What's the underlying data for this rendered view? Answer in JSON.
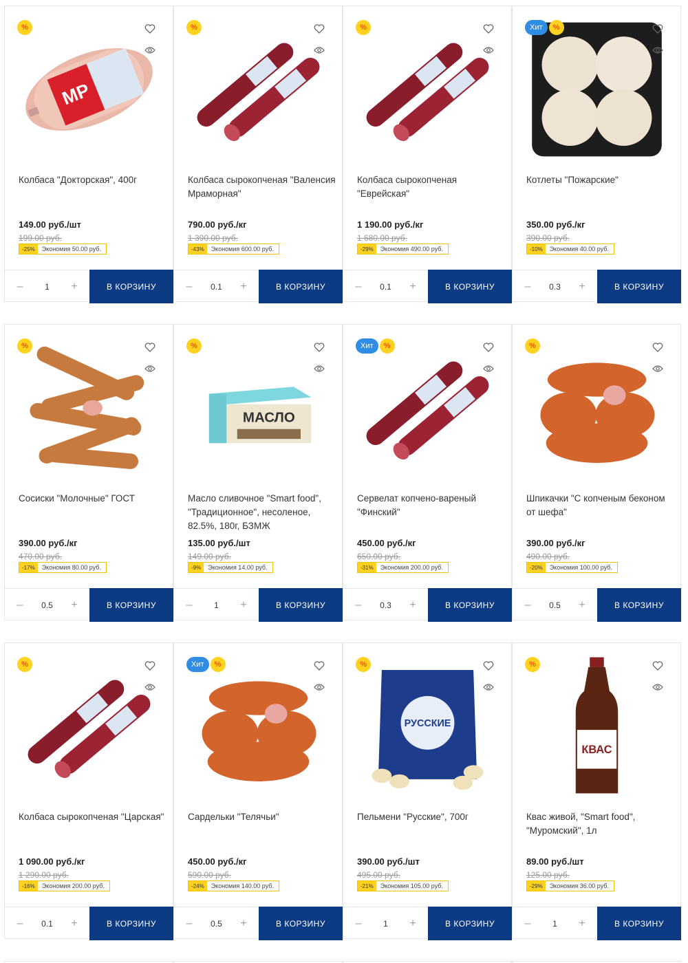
{
  "labels": {
    "cart_button": "В КОРЗИНУ",
    "sale_badge": "%",
    "hit_badge": "Хит",
    "minus": "–",
    "plus": "+"
  },
  "products": [
    {
      "name": "Колбаса \"Докторская\", 400г",
      "price": "149.00 руб./шт",
      "old_price": "199.00 руб.",
      "discount": "-25%",
      "saving": "Экономия 50.00 руб.",
      "qty": "1",
      "hit": false,
      "image_icon": "boiled-sausage-icon"
    },
    {
      "name": "Колбаса сырокопченая \"Валенсия Мраморная\"",
      "price": "790.00 руб./кг",
      "old_price": "1 390.00 руб.",
      "discount": "-43%",
      "saving": "Экономия 600.00 руб.",
      "qty": "0.1",
      "hit": false,
      "image_icon": "salami-icon"
    },
    {
      "name": "Колбаса сырокопченая \"Еврейская\"",
      "price": "1 190.00 руб./кг",
      "old_price": "1 680.00 руб.",
      "discount": "-29%",
      "saving": "Экономия 490.00 руб.",
      "qty": "0.1",
      "hit": false,
      "image_icon": "salami-icon"
    },
    {
      "name": "Котлеты \"Пожарские\"",
      "price": "350.00 руб./кг",
      "old_price": "390.00 руб.",
      "discount": "-10%",
      "saving": "Экономия 40.00 руб.",
      "qty": "0.3",
      "hit": true,
      "image_icon": "cutlets-tray-icon"
    },
    {
      "name": "Сосиски \"Молочные\" ГОСТ",
      "price": "390.00 руб./кг",
      "old_price": "470.00 руб.",
      "discount": "-17%",
      "saving": "Экономия 80.00 руб.",
      "qty": "0.5",
      "hit": false,
      "image_icon": "sausages-icon"
    },
    {
      "name": "Масло сливочное \"Smart food\", \"Традиционное\", несоленое, 82.5%, 180г, БЗМЖ",
      "price": "135.00 руб./шт",
      "old_price": "149.00 руб.",
      "discount": "-9%",
      "saving": "Экономия 14.00 руб.",
      "qty": "1",
      "hit": false,
      "image_icon": "butter-pack-icon"
    },
    {
      "name": "Сервелат копчено-вареный \"Финский\"",
      "price": "450.00 руб./кг",
      "old_price": "650.00 руб.",
      "discount": "-31%",
      "saving": "Экономия 200.00 руб.",
      "qty": "0.3",
      "hit": true,
      "image_icon": "salami-icon"
    },
    {
      "name": "Шпикачки \"С копченым беконом от шефа\"",
      "price": "390.00 руб./кг",
      "old_price": "490.00 руб.",
      "discount": "-20%",
      "saving": "Экономия 100.00 руб.",
      "qty": "0.5",
      "hit": false,
      "image_icon": "sausage-links-icon"
    },
    {
      "name": "Колбаса сырокопченая \"Царская\"",
      "price": "1 090.00 руб./кг",
      "old_price": "1 290.00 руб.",
      "discount": "-16%",
      "saving": "Экономия 200.00 руб.",
      "qty": "0.1",
      "hit": false,
      "image_icon": "salami-icon"
    },
    {
      "name": "Сардельки \"Телячьи\"",
      "price": "450.00 руб./кг",
      "old_price": "590.00 руб.",
      "discount": "-24%",
      "saving": "Экономия 140.00 руб.",
      "qty": "0.5",
      "hit": true,
      "image_icon": "sausage-links-icon"
    },
    {
      "name": "Пельмени \"Русские\", 700г",
      "price": "390.00 руб./шт",
      "old_price": "495.00 руб.",
      "discount": "-21%",
      "saving": "Экономия 105.00 руб.",
      "qty": "1",
      "hit": false,
      "image_icon": "dumplings-bag-icon"
    },
    {
      "name": "Квас живой, \"Smart food\", \"Муромский\", 1л",
      "price": "89.00 руб./шт",
      "old_price": "125.00 руб.",
      "discount": "-29%",
      "saving": "Экономия 36.00 руб.",
      "qty": "1",
      "hit": false,
      "image_icon": "kvass-bottle-icon"
    }
  ],
  "colors": {
    "cart_button": "#0c3b84",
    "sale_badge": "#ffd21f",
    "hit_badge": "#2f8de4"
  }
}
